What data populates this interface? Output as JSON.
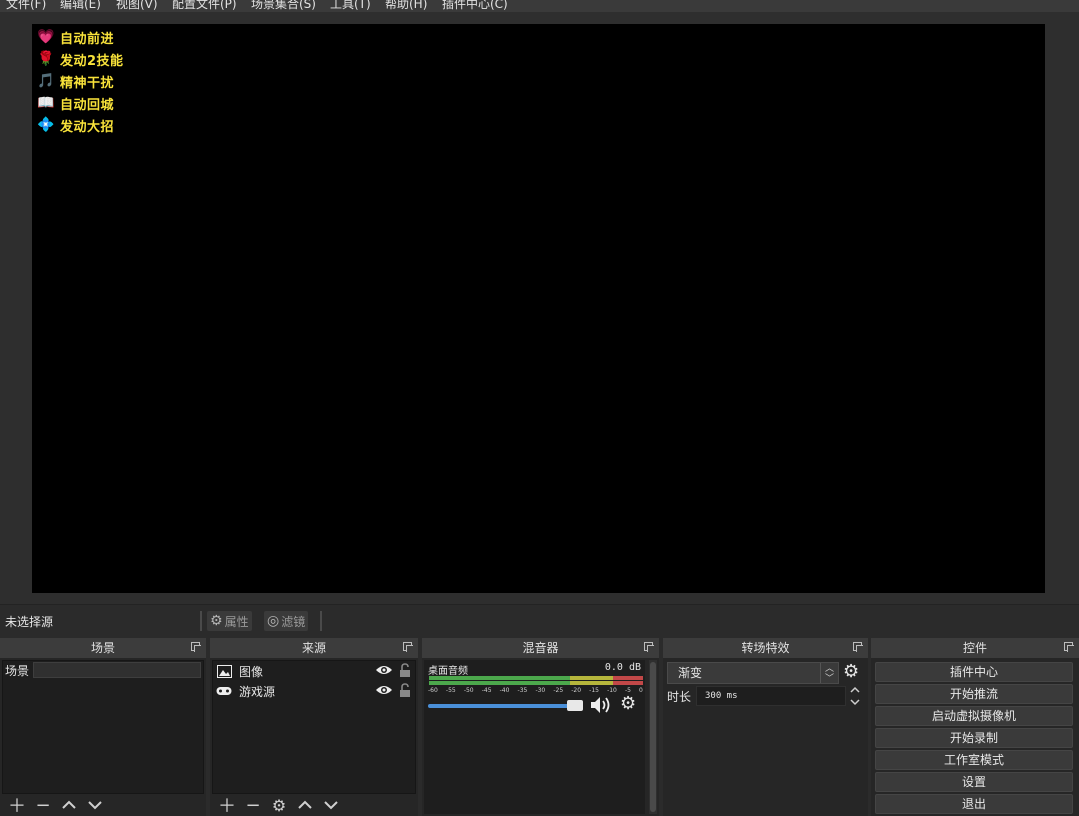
{
  "menu": [
    "文件(F)",
    "编辑(E)",
    "视图(V)",
    "配置文件(P)",
    "场景集合(S)",
    "工具(T)",
    "帮助(H)",
    "插件中心(C)"
  ],
  "overlay": [
    {
      "icon": "💗",
      "label": "自动前进"
    },
    {
      "icon": "🌹",
      "label": "发动2技能"
    },
    {
      "icon": "🎵",
      "label": "精神干扰"
    },
    {
      "icon": "📖",
      "label": "自动回城"
    },
    {
      "icon": "💠",
      "label": "发动大招"
    }
  ],
  "source_toolbar": {
    "no_selection": "未选择源",
    "properties": "属性",
    "filters": "滤镜"
  },
  "docks": {
    "scenes": {
      "title": "场景",
      "items": [
        "场景"
      ]
    },
    "sources": {
      "title": "来源",
      "items": [
        {
          "label": "图像",
          "icon": "image-icon"
        },
        {
          "label": "游戏源",
          "icon": "gamepad-icon"
        }
      ]
    },
    "mixer": {
      "title": "混音器",
      "channel": "桌面音频",
      "level": "0.0 dB",
      "ticks": [
        "-60",
        "-55",
        "-50",
        "-45",
        "-40",
        "-35",
        "-30",
        "-25",
        "-20",
        "-15",
        "-10",
        "-5",
        "0"
      ]
    },
    "transitions": {
      "title": "转场特效",
      "selected": "渐变",
      "duration_label": "时长",
      "duration_value": "300 ms"
    },
    "controls": {
      "title": "控件",
      "buttons": [
        "插件中心",
        "开始推流",
        "启动虚拟摄像机",
        "开始录制",
        "工作室模式",
        "设置",
        "退出"
      ]
    }
  },
  "colors": {
    "accent": "#4a8fd8",
    "overlay_text": "#f8e23a"
  }
}
